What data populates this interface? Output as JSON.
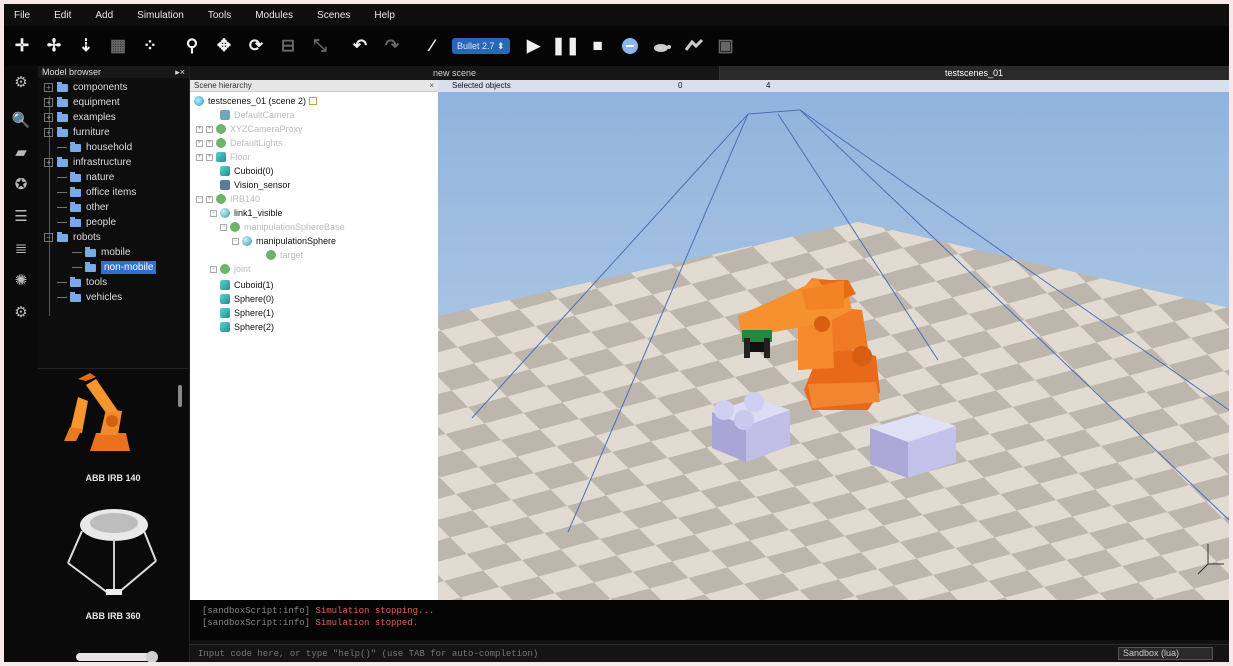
{
  "menu": [
    "File",
    "Edit",
    "Add",
    "Simulation",
    "Tools",
    "Modules",
    "Scenes",
    "Help"
  ],
  "toolbar": {
    "engine": "Bullet 2.7",
    "icons": [
      "move-camera-icon",
      "rotate-camera-icon",
      "fit-view-icon",
      "camera-angle-icon",
      "select-icon",
      "object-shift-icon",
      "object-rotate-icon",
      "object-assemble-icon",
      "path-edit-icon",
      "undo-icon",
      "redo-icon",
      "dynamics-icon",
      "engine-select",
      "play-icon",
      "pause-icon",
      "stop-icon",
      "real-time-icon",
      "slow-down-icon",
      "speed-up-icon",
      "threaded-render-icon"
    ]
  },
  "model_browser": {
    "title": "Model browser",
    "folders": [
      {
        "label": "components"
      },
      {
        "label": "equipment"
      },
      {
        "label": "examples"
      },
      {
        "label": "furniture"
      },
      {
        "label": "household"
      },
      {
        "label": "infrastructure"
      },
      {
        "label": "nature"
      },
      {
        "label": "office items"
      },
      {
        "label": "other"
      },
      {
        "label": "people"
      },
      {
        "label": "robots"
      },
      {
        "label": "mobile"
      },
      {
        "label": "non-mobile"
      },
      {
        "label": "tools"
      },
      {
        "label": "vehicles"
      }
    ],
    "selected": "non-mobile",
    "thumbnails": [
      "ABB IRB 140",
      "ABB IRB 360"
    ]
  },
  "tabs": [
    "new scene",
    "testscenes_01"
  ],
  "active_tab": "testscenes_01",
  "scene_hierarchy": {
    "title": "Scene hierarchy",
    "items": [
      {
        "label": "testscenes_01 (scene 2)"
      },
      {
        "label": "DefaultCamera"
      },
      {
        "label": "XYZCameraProxy"
      },
      {
        "label": "DefaultLights"
      },
      {
        "label": "Floor"
      },
      {
        "label": "Cuboid(0)"
      },
      {
        "label": "Vision_sensor"
      },
      {
        "label": "IRB140"
      },
      {
        "label": "link1_visible"
      },
      {
        "label": "manipulationSphereBase"
      },
      {
        "label": "manipulationSphere"
      },
      {
        "label": "target"
      },
      {
        "label": "joint"
      },
      {
        "label": "Cuboid(1)"
      },
      {
        "label": "Sphere(0)"
      },
      {
        "label": "Sphere(1)"
      },
      {
        "label": "Sphere(2)"
      }
    ]
  },
  "viewport": {
    "info_label": "Selected objects",
    "info_value_1": "0",
    "info_value_2": "4"
  },
  "console": {
    "lines": [
      {
        "source": "[sandboxScript:info]",
        "message": "Simulation stopping..."
      },
      {
        "source": "[sandboxScript:info]",
        "message": "Simulation stopped."
      }
    ],
    "input_placeholder": "Input code here, or type \"help()\" (use TAB for auto-completion)",
    "sandbox_label": "Sandbox (lua)"
  },
  "colors": {
    "accent": "#2e6fd0",
    "robot": "#f07a1e",
    "objects": "#c9c8ea"
  }
}
